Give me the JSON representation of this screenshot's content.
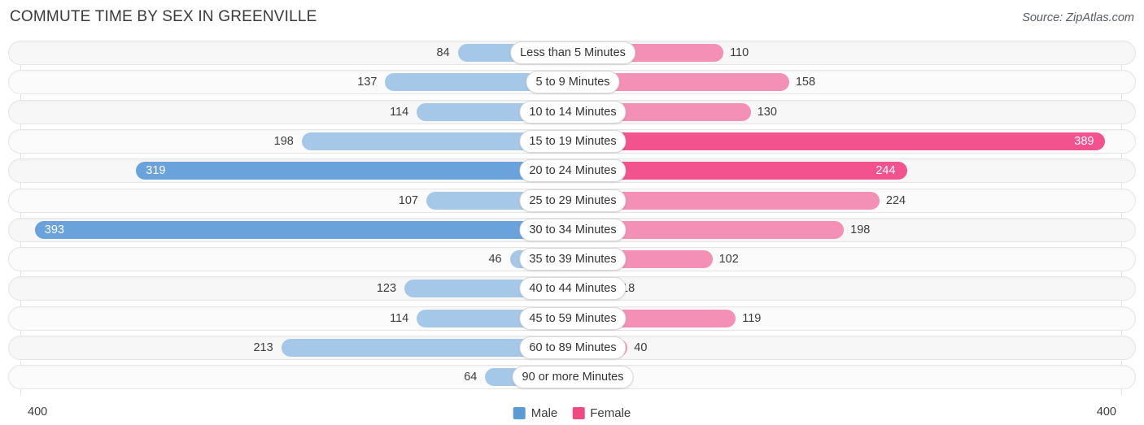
{
  "header": {
    "title": "COMMUTE TIME BY SEX IN GREENVILLE",
    "source": "Source: ZipAtlas.com"
  },
  "axis": {
    "left_label": "400",
    "right_label": "400"
  },
  "legend": {
    "items": [
      {
        "label": "Male",
        "color": "#5b9bd5"
      },
      {
        "label": "Female",
        "color": "#ef4b82"
      }
    ]
  },
  "colors": {
    "male_light": "#a5c8e8",
    "male_dark": "#6aa3dc",
    "female_light": "#f48fb5",
    "female_dark": "#f2528d",
    "track": "#f7f7f7",
    "track_alt": "#fbfbfb"
  },
  "chart_data": {
    "type": "bar",
    "title": "COMMUTE TIME BY SEX IN GREENVILLE",
    "subtitle": "Source: ZipAtlas.com",
    "orientation": "horizontal-diverging",
    "xlabel": "",
    "ylabel": "",
    "xlim": [
      400,
      400
    ],
    "axis_max": 400,
    "grid": true,
    "legend_position": "bottom-center",
    "categories": [
      "Less than 5 Minutes",
      "5 to 9 Minutes",
      "10 to 14 Minutes",
      "15 to 19 Minutes",
      "20 to 24 Minutes",
      "25 to 29 Minutes",
      "30 to 34 Minutes",
      "35 to 39 Minutes",
      "40 to 44 Minutes",
      "45 to 59 Minutes",
      "60 to 89 Minutes",
      "90 or more Minutes"
    ],
    "series": [
      {
        "name": "Male",
        "side": "left",
        "values": [
          84,
          137,
          114,
          198,
          319,
          107,
          393,
          46,
          123,
          114,
          213,
          64
        ],
        "labels": [
          "84",
          "137",
          "114",
          "198",
          "319",
          "107",
          "393",
          "46",
          "123",
          "114",
          "213",
          "64"
        ],
        "label_inside": [
          false,
          false,
          false,
          false,
          true,
          false,
          true,
          false,
          false,
          false,
          false,
          false
        ]
      },
      {
        "name": "Female",
        "side": "right",
        "values": [
          110,
          158,
          130,
          389,
          244,
          224,
          198,
          102,
          18,
          119,
          40,
          0
        ],
        "labels": [
          "110",
          "158",
          "130",
          "389",
          "244",
          "224",
          "198",
          "102",
          "18",
          "119",
          "40",
          "0"
        ],
        "label_inside": [
          false,
          false,
          false,
          true,
          true,
          false,
          false,
          false,
          false,
          false,
          false,
          false
        ]
      }
    ]
  }
}
